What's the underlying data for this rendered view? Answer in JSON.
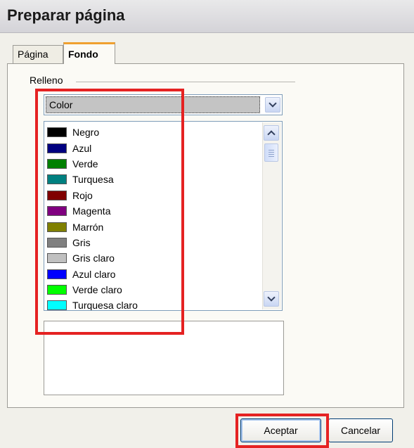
{
  "window": {
    "title": "Preparar página"
  },
  "tabs": [
    {
      "label": "Página",
      "active": false
    },
    {
      "label": "Fondo",
      "active": true
    }
  ],
  "fill": {
    "group_label": "Relleno",
    "selected": "Color",
    "colors": [
      {
        "name": "Negro",
        "hex": "#000000"
      },
      {
        "name": "Azul",
        "hex": "#000080"
      },
      {
        "name": "Verde",
        "hex": "#008000"
      },
      {
        "name": "Turquesa",
        "hex": "#008080"
      },
      {
        "name": "Rojo",
        "hex": "#800000"
      },
      {
        "name": "Magenta",
        "hex": "#800080"
      },
      {
        "name": "Marrón",
        "hex": "#808000"
      },
      {
        "name": "Gris",
        "hex": "#808080"
      },
      {
        "name": "Gris claro",
        "hex": "#c0c0c0"
      },
      {
        "name": "Azul claro",
        "hex": "#0000ff"
      },
      {
        "name": "Verde claro",
        "hex": "#00ff00"
      },
      {
        "name": "Turquesa claro",
        "hex": "#00ffff"
      }
    ]
  },
  "buttons": {
    "ok": "Aceptar",
    "cancel": "Cancelar"
  },
  "highlight_color": "#e52222"
}
